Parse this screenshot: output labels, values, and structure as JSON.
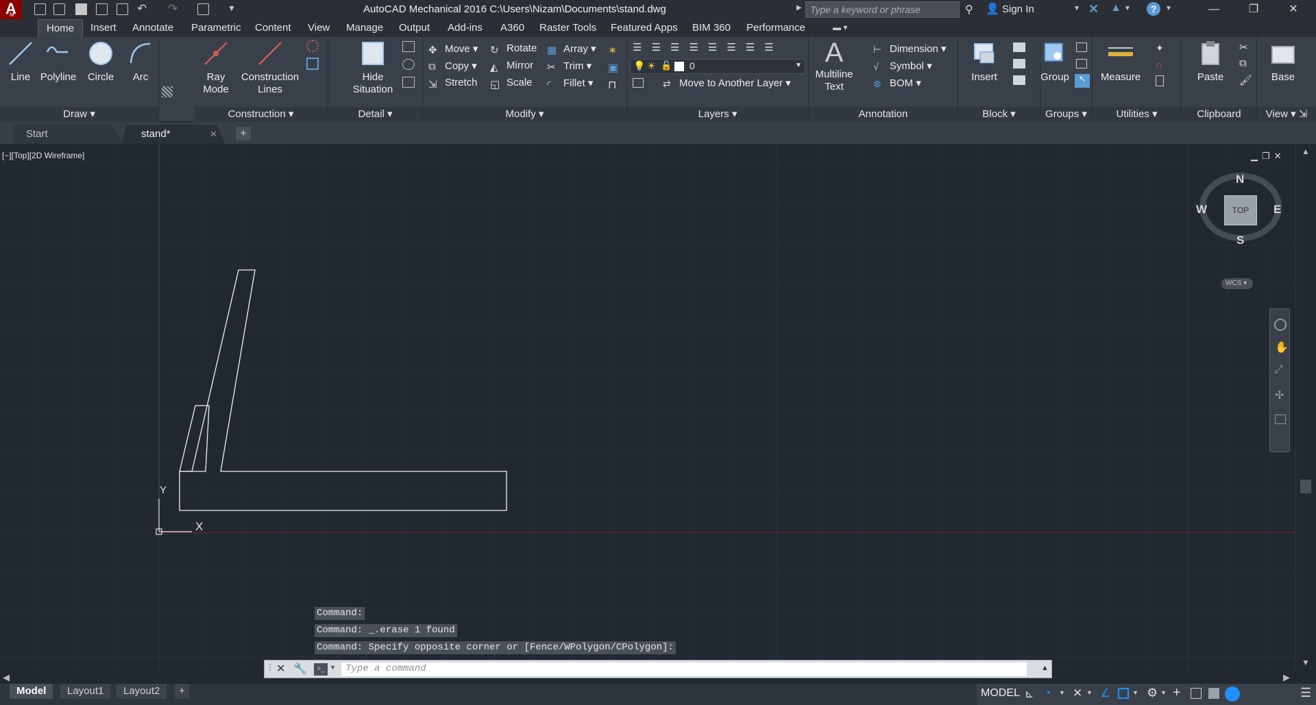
{
  "app": {
    "title": "AutoCAD Mechanical 2016    C:\\Users\\Nizam\\Documents\\stand.dwg",
    "logo_letter": "A",
    "logo_sub": "M",
    "search_placeholder": "Type a keyword or phrase",
    "signin": "Sign In"
  },
  "ribbon_tabs": [
    "Home",
    "Insert",
    "Annotate",
    "Parametric",
    "Content",
    "View",
    "Manage",
    "Output",
    "Add-ins",
    "A360",
    "Raster Tools",
    "Featured Apps",
    "BIM 360",
    "Performance"
  ],
  "panels": {
    "draw": {
      "title": "Draw",
      "line": "Line",
      "polyline": "Polyline",
      "circle": "Circle",
      "arc": "Arc"
    },
    "construction": {
      "title": "Construction",
      "ray": "Ray\nMode",
      "construction_lines": "Construction\nLines"
    },
    "detail": {
      "title": "Detail",
      "hide": "Hide\nSituation"
    },
    "modify": {
      "title": "Modify",
      "move": "Move",
      "rotate": "Rotate",
      "array": "Array",
      "copy": "Copy",
      "mirror": "Mirror",
      "trim": "Trim",
      "stretch": "Stretch",
      "scale": "Scale",
      "fillet": "Fillet"
    },
    "layers": {
      "title": "Layers",
      "current_layer": "0",
      "move_layer": "Move to Another Layer"
    },
    "annotation": {
      "title": "Annotation",
      "mtext": "Multiline\nText",
      "dimension": "Dimension",
      "symbol": "Symbol",
      "bom": "BOM"
    },
    "block": {
      "title": "Block",
      "insert": "Insert"
    },
    "groups": {
      "title": "Groups",
      "group": "Group"
    },
    "utilities": {
      "title": "Utilities",
      "measure": "Measure"
    },
    "clipboard": {
      "title": "Clipboard",
      "paste": "Paste"
    },
    "view": {
      "title": "View",
      "base": "Base"
    }
  },
  "file_tabs": [
    "Start",
    "stand*"
  ],
  "viewport": {
    "label": "[−][Top][2D Wireframe]",
    "compass": {
      "n": "N",
      "s": "S",
      "e": "E",
      "w": "W",
      "cube": "TOP",
      "wcs": "WCS"
    },
    "ucs": {
      "x": "X",
      "y": "Y"
    }
  },
  "command": {
    "history": [
      "Command:",
      "Command: _.erase 1 found",
      "Command: Specify opposite corner or [Fence/WPolygon/CPolygon]:"
    ],
    "placeholder": "Type a command"
  },
  "layout_tabs": [
    "Model",
    "Layout1",
    "Layout2"
  ],
  "status": {
    "model": "MODEL"
  },
  "colors": {
    "accent": "#1e90ff",
    "canvas": "#212830",
    "y_axis": "#2e6b2e",
    "x_axis": "#7a2626"
  }
}
